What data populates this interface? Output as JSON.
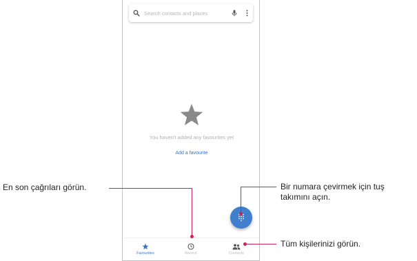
{
  "search": {
    "placeholder": "Search contacts and places"
  },
  "empty_state": {
    "message": "You haven't added any favourites yet",
    "add_link": "Add a favourite"
  },
  "nav": {
    "items": [
      {
        "label": "Favourites",
        "icon": "star-icon"
      },
      {
        "label": "Recent",
        "icon": "clock-icon"
      },
      {
        "label": "Contacts",
        "icon": "people-icon"
      }
    ]
  },
  "callouts": {
    "recent": "En son çağrıları görün.",
    "dialpad_line1": "Bir numara çevirmek için tuş",
    "dialpad_line2": "takımını açın.",
    "contacts": "Tüm kişilerinizi görün."
  },
  "colors": {
    "accent": "#3f7fce",
    "callout_line": "#c8245a",
    "star_grey": "#8a8a8a"
  }
}
